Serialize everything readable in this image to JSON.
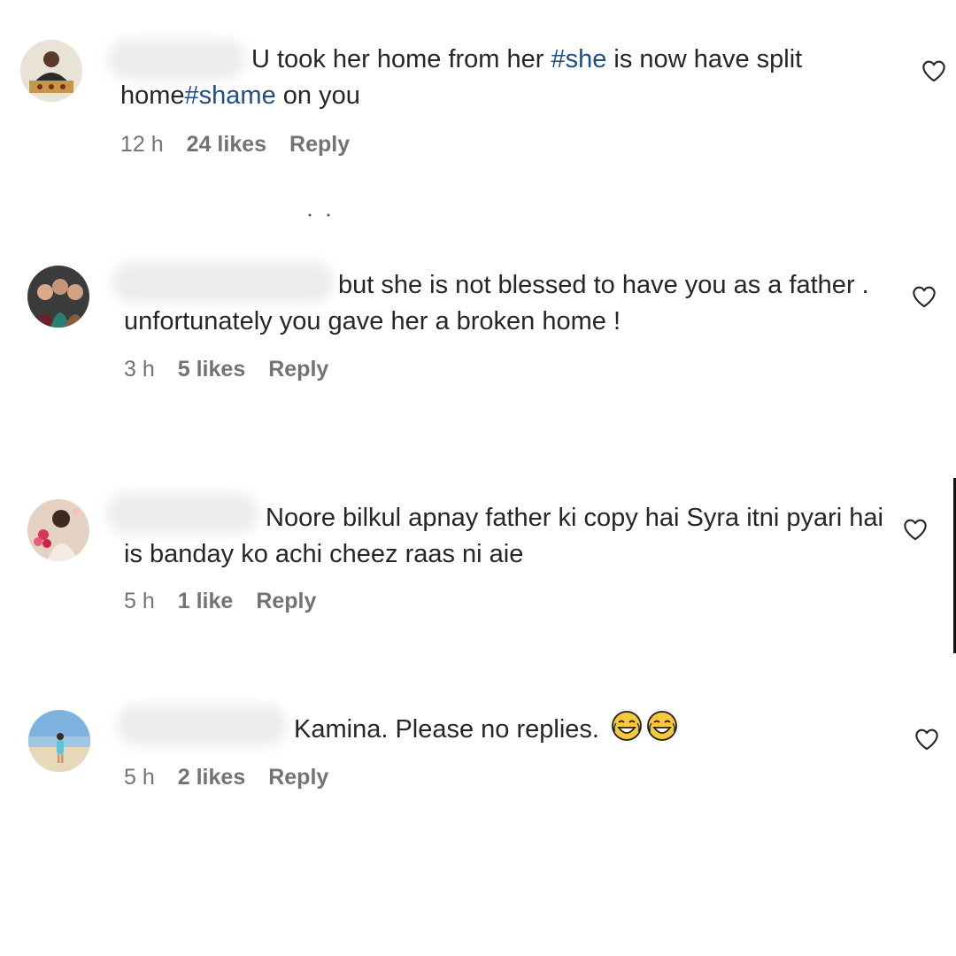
{
  "comments": [
    {
      "text_before": "U took her home from her ",
      "tag1": "#she",
      "text_middle": " is now have split home",
      "tag2": "#shame",
      "text_after": " on you",
      "time": "12 h",
      "likes": "24 likes",
      "reply": "Reply"
    },
    {
      "text": "but she is not blessed to have you as a father . unfortunately you gave her a broken home !",
      "time": "3 h",
      "likes": "5 likes",
      "reply": "Reply"
    },
    {
      "text": "Noore bilkul apnay father ki copy hai Syra itni pyari hai is banday ko achi cheez raas ni aie",
      "time": "5 h",
      "likes": "1 like",
      "reply": "Reply"
    },
    {
      "text": "Kamina. Please no replies.",
      "emoji": "😂😂",
      "time": "5 h",
      "likes": "2 likes",
      "reply": "Reply"
    }
  ],
  "icons": {
    "like": "heart-outline-icon",
    "emoji": "tears-of-joy-emoji"
  },
  "colors": {
    "text": "#262626",
    "meta": "#737373",
    "hashtag": "#1d4e89"
  }
}
